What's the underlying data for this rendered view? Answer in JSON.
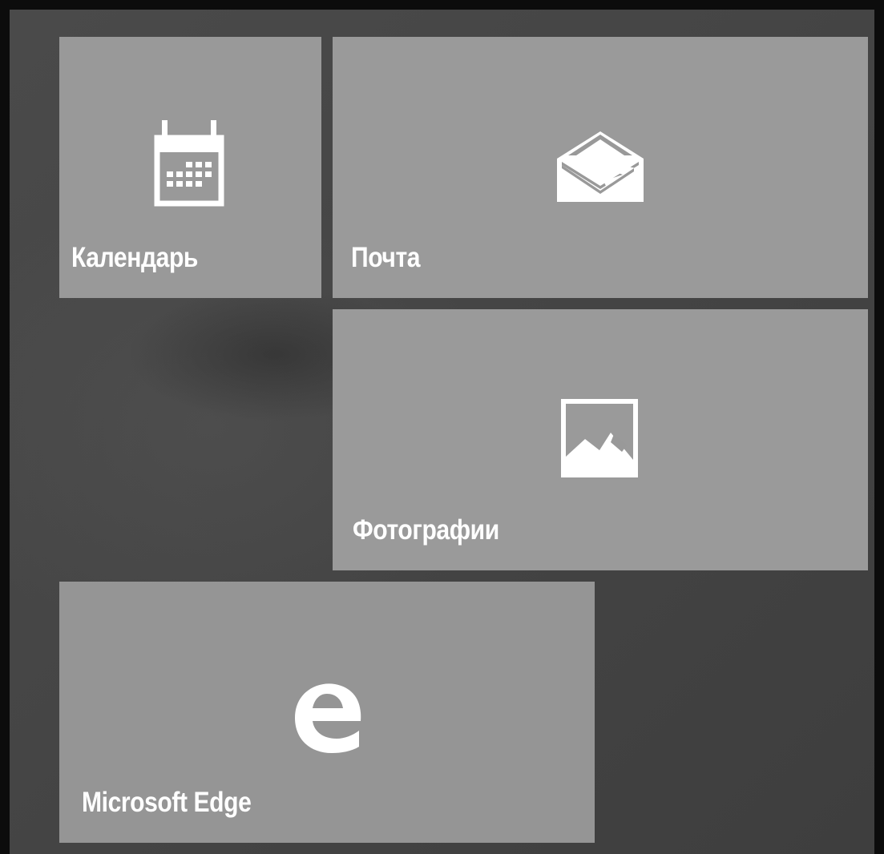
{
  "start_menu": {
    "tiles": [
      {
        "label": "Календарь",
        "icon": "calendar-icon"
      },
      {
        "label": "Почта",
        "icon": "mail-icon"
      },
      {
        "label": "Фотографии",
        "icon": "photos-icon"
      },
      {
        "label": "Microsoft Edge",
        "icon": "edge-icon"
      }
    ]
  },
  "colors": {
    "tile_background": "#999999",
    "desktop_background": "#454545",
    "frame_border": "#0c0c0c",
    "label_text": "#ffffff"
  }
}
